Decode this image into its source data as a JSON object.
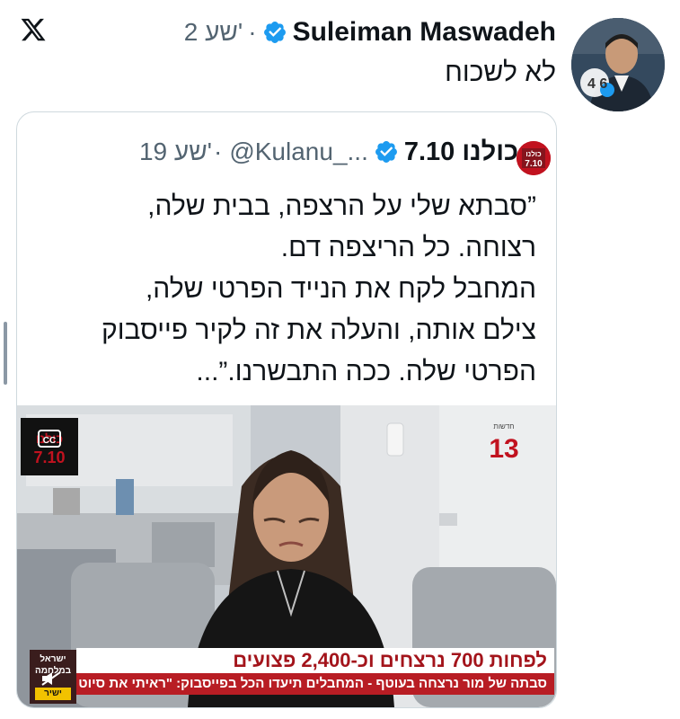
{
  "app": {
    "logo_icon": "x-logo-icon"
  },
  "tweet": {
    "author_name": "Suleiman Maswadeh",
    "time": "2 שע'",
    "separator": "·",
    "text": "לא לשכוח",
    "avatar_badge": "4 6"
  },
  "quoted_tweet": {
    "name": "כולנו 7.10",
    "handle": "@Kulanu_...",
    "time": "19 שע'",
    "separator": "·",
    "logo_text": "כולנו 7.10",
    "body_lines": [
      "”סבתא שלי על הרצפה, בבית שלה,",
      "רצוחה. כל הריצפה דם.",
      "המחבל לקח את הנייד הפרטי שלה,",
      "צילם אותה, והעלה את זה לקיר פייסבוק",
      "הפרטי שלה. ככה התבשרנו.”..."
    ],
    "media": {
      "channel_logo": "13",
      "cc_label": "CC",
      "corner_logo_text": "כולנו 7.10",
      "ticker_headline": "לפחות 700 נרצחים וכ-2,400 פצועים",
      "ticker_sub": "סבתה של מור נרצחה בעוטף - המחבלים תיעדו הכל בפייסבוק: \"ראיתי את סיוט חיי\"",
      "bug_text": "ישראל במלחמה",
      "live_label": "ישיר"
    }
  },
  "colors": {
    "verified": "#1d9bf0",
    "muted": "#536471",
    "border": "#cfd9de",
    "ticker_red": "#b81d24"
  }
}
